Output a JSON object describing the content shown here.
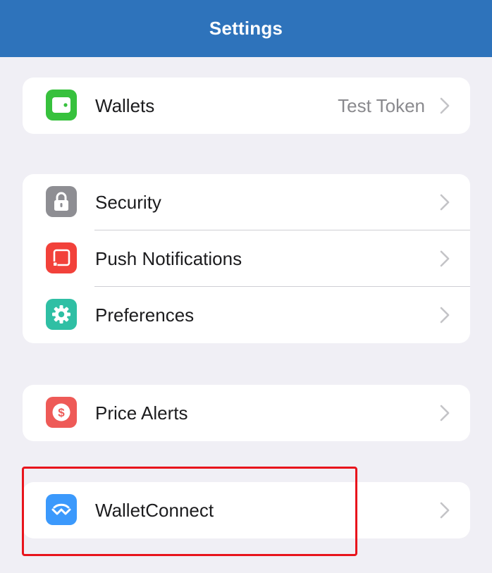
{
  "header": {
    "title": "Settings"
  },
  "groups": [
    {
      "items": [
        {
          "label": "Wallets",
          "value": "Test Token",
          "icon": "wallet-icon",
          "color": "#37c13d"
        }
      ]
    },
    {
      "items": [
        {
          "label": "Security",
          "icon": "lock-icon",
          "color": "#8e8e93"
        },
        {
          "label": "Push Notifications",
          "icon": "notification-icon",
          "color": "#f2413a"
        },
        {
          "label": "Preferences",
          "icon": "gear-icon",
          "color": "#2fbfa4"
        }
      ]
    },
    {
      "items": [
        {
          "label": "Price Alerts",
          "icon": "dollar-coin-icon",
          "color": "#ee5a57"
        }
      ]
    },
    {
      "items": [
        {
          "label": "WalletConnect",
          "icon": "walletconnect-icon",
          "color": "#3b99fc"
        }
      ]
    }
  ],
  "colors": {
    "navbar": "#2e73bb",
    "background": "#f0eff5",
    "highlight_box": "#e8141c"
  }
}
